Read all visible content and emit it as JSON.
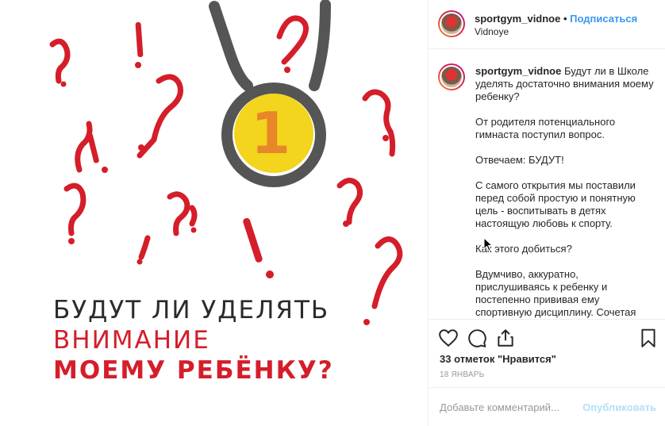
{
  "post_image": {
    "line1": "БУДУТ ЛИ УДЕЛЯТЬ",
    "line2": "ВНИМАНИЕ",
    "line3": "МОЕМУ РЕБЁНКУ?",
    "medal_number": "1",
    "colors": {
      "accent_red": "#d41e2a",
      "medal_gold": "#f2d51c",
      "medal_number": "#e8862a",
      "ribbon": "#555555"
    }
  },
  "header": {
    "username": "sportgym_vidnoe",
    "separator": "•",
    "follow_label": "Подписаться",
    "location": "Vidnoye"
  },
  "caption": {
    "username": "sportgym_vidnoe",
    "first_line": "Будут ли в Школе уделять достаточно внимания моему ребенку?",
    "paragraphs": [
      "От родителя потенциального гимнаста поступил вопрос.",
      "Отвечаем: БУДУТ!",
      "С самого открытия мы поставили перед собой простую и понятную цель - воспитывать в детях настоящую любовь к спорту.",
      "Как этого добиться?",
      "Вдумчиво, аккуратно, прислушиваясь к ребенку и постепенно прививая ему спортивную дисциплину. Сочетая"
    ]
  },
  "actions": {
    "likes_text": "33 отметок \"Нравится\"",
    "date": "18 ЯНВАРЬ"
  },
  "add_comment": {
    "placeholder": "Добавьте комментарий...",
    "publish_label": "Опубликовать"
  },
  "colors": {
    "link": "#3897f0",
    "publish_disabled": "#b2dffc",
    "muted": "#999999"
  }
}
